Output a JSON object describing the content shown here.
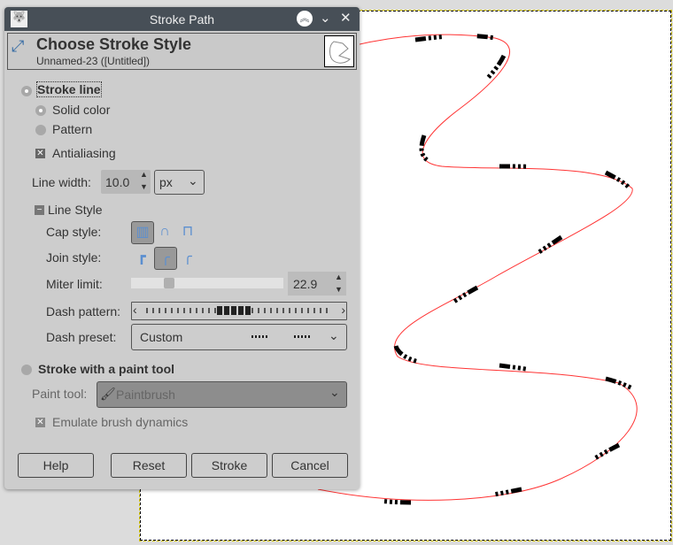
{
  "window": {
    "title": "Stroke Path"
  },
  "header": {
    "title": "Choose Stroke Style",
    "subtitle": "Unnamed-23 ([Untitled])"
  },
  "stroke_line": {
    "label": "Stroke line",
    "selected": true,
    "solid_color": "Solid color",
    "pattern": "Pattern",
    "antialiasing": "Antialiasing",
    "line_width_label": "Line width:",
    "line_width": "10.0",
    "unit": "px"
  },
  "line_style": {
    "label": "Line Style",
    "cap_label": "Cap style:",
    "join_label": "Join style:",
    "miter_label": "Miter limit:",
    "miter_value": "22.9",
    "miter_fraction": 0.23,
    "dash_pattern_label": "Dash pattern:",
    "dash_preset_label": "Dash preset:",
    "dash_preset": "Custom"
  },
  "paint_tool": {
    "label": "Stroke with a paint tool",
    "tool_label": "Paint tool:",
    "tool": "Paintbrush",
    "emulate": "Emulate brush dynamics"
  },
  "buttons": {
    "help": "Help",
    "reset": "Reset",
    "stroke": "Stroke",
    "cancel": "Cancel"
  },
  "colors": {
    "path": "#ff3333",
    "titlebar": "#474f57",
    "dialog": "#cdcdcd"
  }
}
